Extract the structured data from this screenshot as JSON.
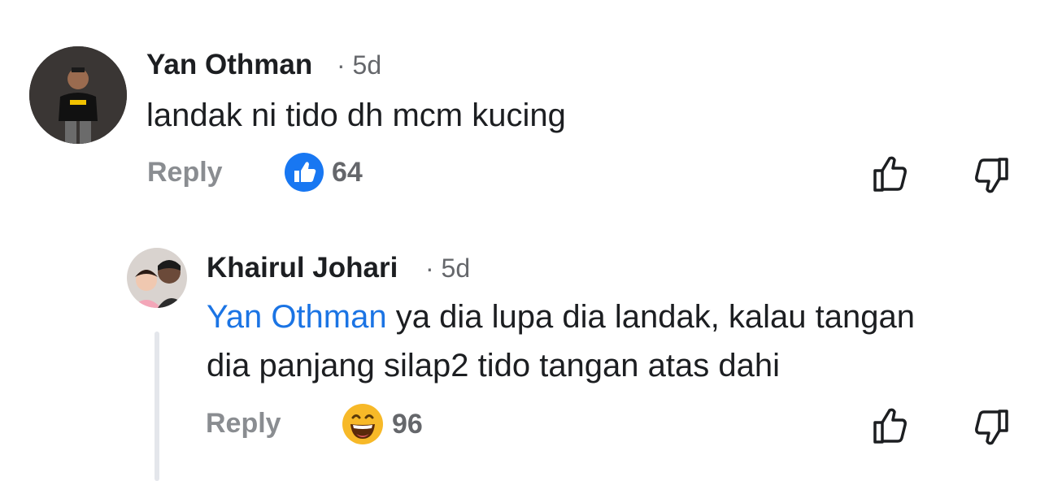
{
  "comments": [
    {
      "author": "Yan Othman",
      "time": "· 5d",
      "text": "landak ni tido dh mcm kucing",
      "reply_label": "Reply",
      "reaction_count": "64",
      "reaction_icon": "like-icon"
    }
  ],
  "replies": [
    {
      "author": "Khairul Johari",
      "time": "· 5d",
      "mention": "Yan Othman",
      "text_line1": "ya dia lupa dia landak, kalau tangan",
      "text_line2": "dia panjang silap2 tido tangan atas dahi",
      "reply_label": "Reply",
      "reaction_count": "96",
      "reaction_icon": "haha-icon"
    }
  ],
  "colors": {
    "mention": "#1b74e4",
    "like_blue": "#1877f2",
    "haha_yellow": "#f7b928"
  }
}
